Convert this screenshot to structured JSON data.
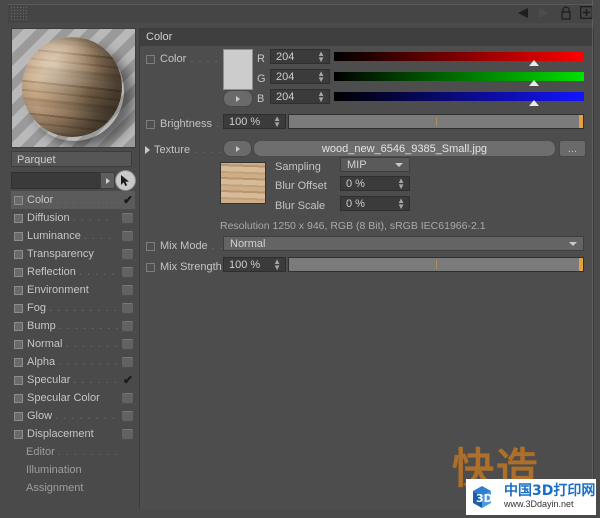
{
  "titlebar": {
    "icons": [
      {
        "name": "back-arrow-icon",
        "glyph": "◀"
      },
      {
        "name": "forward-arrow-icon",
        "glyph": "▲"
      },
      {
        "name": "lock-icon",
        "glyph": "lock"
      },
      {
        "name": "add-box-icon",
        "glyph": "+"
      }
    ]
  },
  "material": {
    "preview_label": "material-preview",
    "name": "Parquet",
    "search_value": "",
    "channels": [
      {
        "label": "Color",
        "dots": ". . . . . . . . .",
        "enabled": true,
        "selected": true,
        "check": "✔",
        "swatch": false
      },
      {
        "label": "Diffusion",
        "dots": ". . . . .",
        "enabled": true,
        "selected": false,
        "check": "",
        "swatch": true
      },
      {
        "label": "Luminance",
        "dots": ". . . .",
        "enabled": true,
        "selected": false,
        "check": "",
        "swatch": true
      },
      {
        "label": "Transparency",
        "dots": "",
        "enabled": true,
        "selected": false,
        "check": "",
        "swatch": true
      },
      {
        "label": "Reflection",
        "dots": ". . . . .",
        "enabled": true,
        "selected": false,
        "check": "",
        "swatch": true
      },
      {
        "label": "Environment",
        "dots": "",
        "enabled": true,
        "selected": false,
        "check": "",
        "swatch": true
      },
      {
        "label": "Fog",
        "dots": ". . . . . . . . . .",
        "enabled": true,
        "selected": false,
        "check": "",
        "swatch": true
      },
      {
        "label": "Bump",
        "dots": ". . . . . . . .",
        "enabled": true,
        "selected": false,
        "check": "",
        "swatch": true
      },
      {
        "label": "Normal",
        "dots": ". . . . . . .",
        "enabled": true,
        "selected": false,
        "check": "",
        "swatch": true
      },
      {
        "label": "Alpha",
        "dots": ". . . . . . . .",
        "enabled": true,
        "selected": false,
        "check": "",
        "swatch": true
      },
      {
        "label": "Specular",
        "dots": ". . . . . .",
        "enabled": true,
        "selected": false,
        "check": "✔",
        "swatch": false
      },
      {
        "label": "Specular Color",
        "dots": "",
        "enabled": true,
        "selected": false,
        "check": "",
        "swatch": true
      },
      {
        "label": "Glow",
        "dots": ". . . . . . . . .",
        "enabled": true,
        "selected": false,
        "check": "",
        "swatch": true
      },
      {
        "label": "Displacement",
        "dots": "",
        "enabled": true,
        "selected": false,
        "check": "",
        "swatch": true
      }
    ],
    "pages": [
      {
        "label": "Editor",
        "dots": ". . . . . . . ."
      },
      {
        "label": "Illumination",
        "dots": ""
      },
      {
        "label": "Assignment",
        "dots": ""
      }
    ]
  },
  "color_panel": {
    "section_title": "Color",
    "color_row": {
      "label": "Color",
      "dots": ". . . .",
      "swatch_hex": "#cccccc",
      "channels": [
        {
          "name": "R",
          "value": "204",
          "percent": 80
        },
        {
          "name": "G",
          "value": "204",
          "percent": 80
        },
        {
          "name": "B",
          "value": "204",
          "percent": 80
        }
      ]
    },
    "brightness": {
      "label": "Brightness",
      "dots": ".",
      "value": "100 %",
      "percent": 100
    },
    "texture": {
      "label": "Texture",
      "dots": ". . . .",
      "filename": "wood_new_6546_9385_Small.jpg",
      "browse_label": "...",
      "sampling": {
        "label": "Sampling",
        "value": "MIP"
      },
      "blur_offset": {
        "label": "Blur Offset",
        "value": "0 %"
      },
      "blur_scale": {
        "label": "Blur Scale",
        "value": "0 %"
      },
      "resolution_info": "Resolution 1250 x 946, RGB (8 Bit), sRGB IEC61966-2.1"
    },
    "mix_mode": {
      "label": "Mix Mode",
      "dots": ". .",
      "value": "Normal"
    },
    "mix_strength": {
      "label": "Mix Strength",
      "dots": "",
      "value": "100 %",
      "percent": 100
    }
  },
  "watermark": {
    "cn_big": "快造",
    "brand_cn": "中国3D打印网",
    "brand_url": "www.3Ddayin.net",
    "logo_text": "3D"
  }
}
